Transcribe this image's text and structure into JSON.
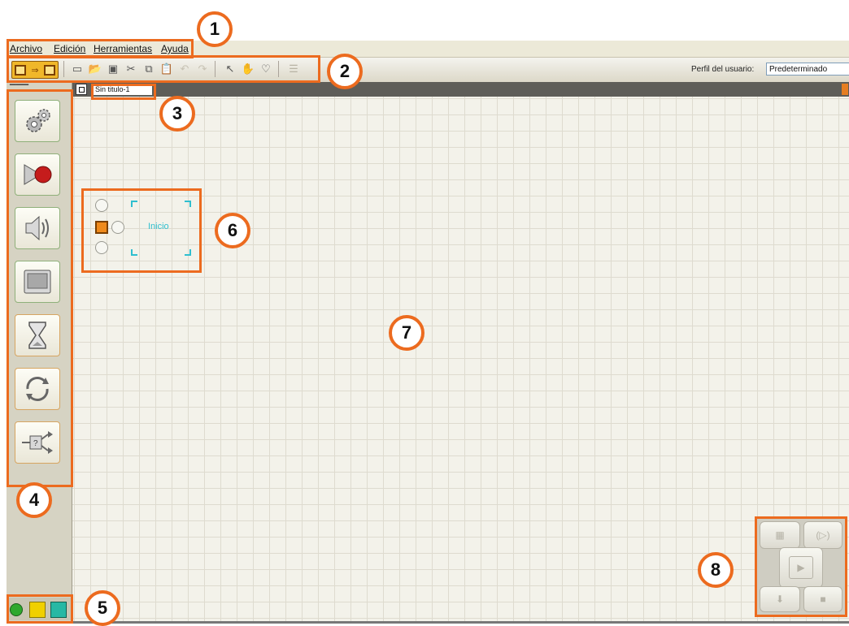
{
  "menubar": {
    "items": [
      {
        "label": "Archivo"
      },
      {
        "label": "Edición"
      },
      {
        "label": "Herramientas"
      },
      {
        "label": "Ayuda"
      }
    ]
  },
  "toolbar": {
    "profile_label": "Perfil del usuario:",
    "profile_value": "Predeterminado"
  },
  "document": {
    "tab_title": "Sin titulo-1"
  },
  "start_block": {
    "label": "Inicio"
  },
  "callouts": [
    "1",
    "2",
    "3",
    "4",
    "5",
    "6",
    "7",
    "8"
  ],
  "colors": {
    "annotation": "#ec6b1f",
    "canvas": "#f3f2ea",
    "start_accent": "#2fbfcf"
  }
}
